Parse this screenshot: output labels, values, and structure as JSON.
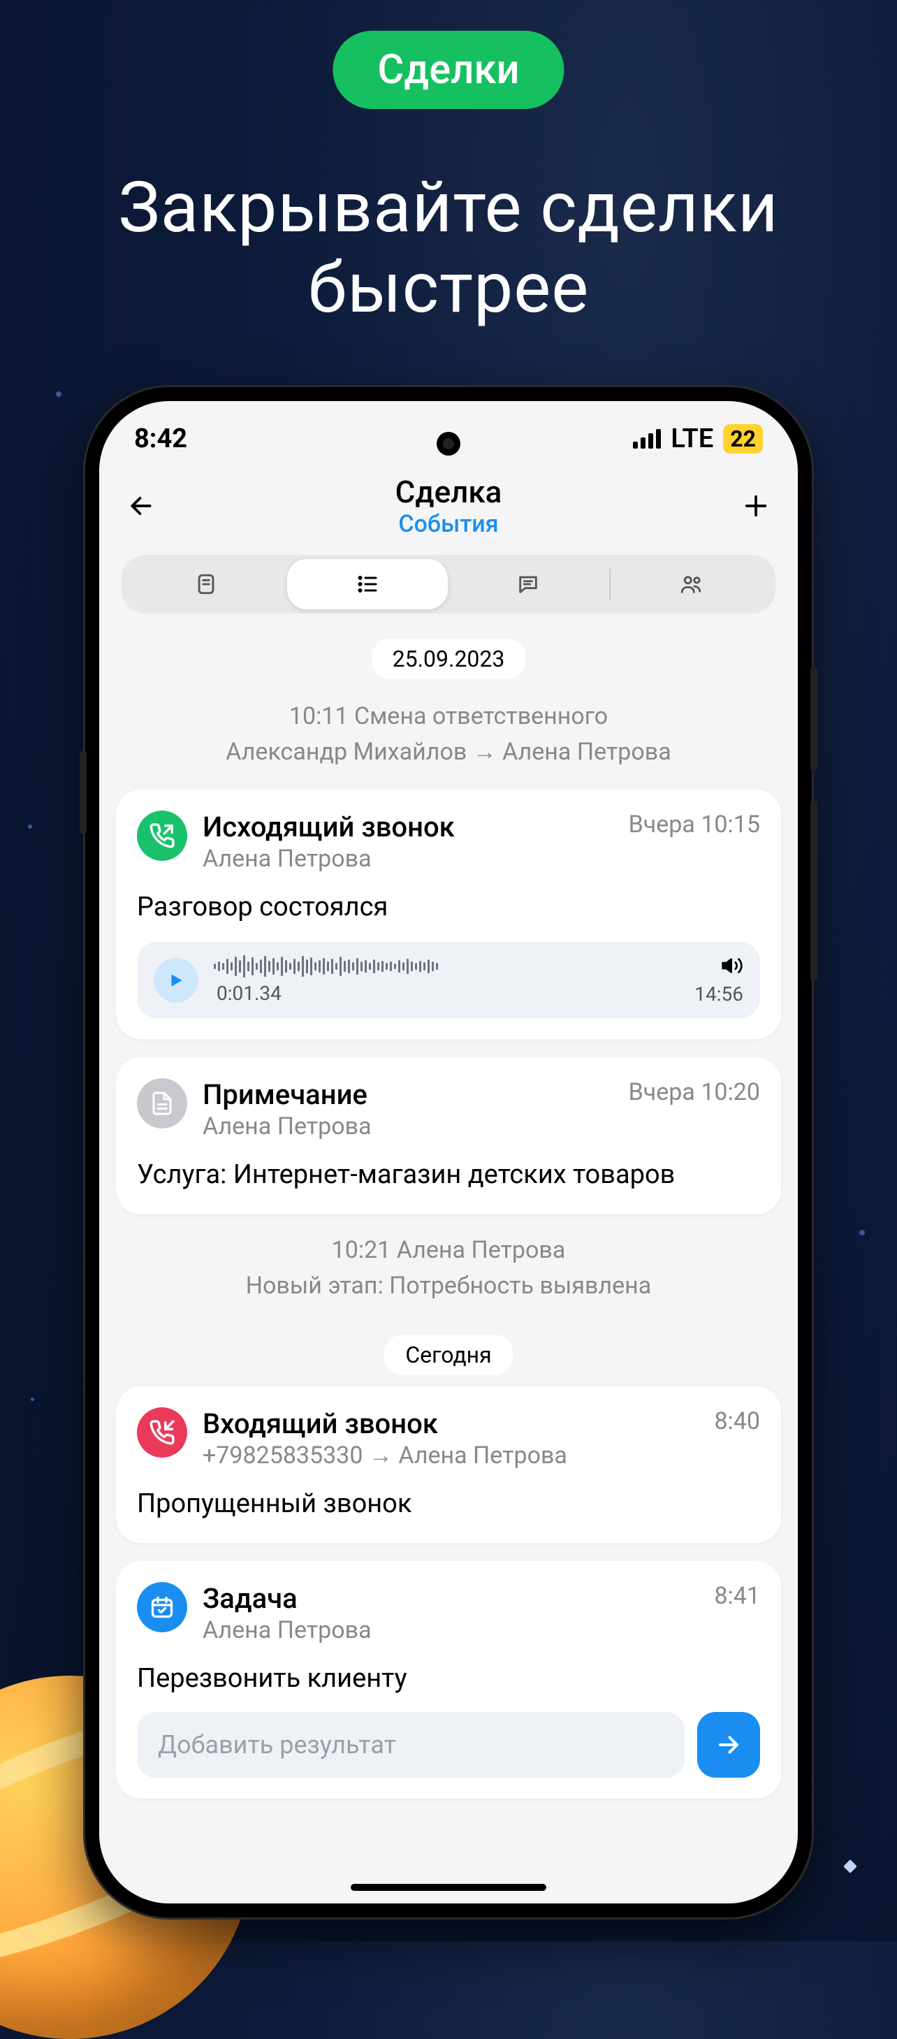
{
  "marketing": {
    "badge": "Сделки",
    "headline_l1": "Закрывайте сделки",
    "headline_l2": "быстрее"
  },
  "status": {
    "time": "8:42",
    "network": "LTE",
    "battery": "22"
  },
  "header": {
    "title": "Сделка",
    "subtitle": "События"
  },
  "timeline": {
    "date1": "25.09.2023",
    "sys1_l1": "10:11 Смена ответственного",
    "sys1_l2": "Александр Михайлов → Алена Петрова",
    "sys2_l1": "10:21 Алена Петрова",
    "sys2_l2": "Новый этап: Потребность выявлена",
    "date2": "Сегодня"
  },
  "cards": {
    "call_out": {
      "title": "Исходящий звонок",
      "sub": "Алена Петрова",
      "time": "Вчера 10:15",
      "body": "Разговор состоялся",
      "elapsed": "0:01.34",
      "duration": "14:56"
    },
    "note": {
      "title": "Примечание",
      "sub": "Алена Петрова",
      "time": "Вчера 10:20",
      "body": "Услуга: Интернет-магазин детских товаров"
    },
    "call_in": {
      "title": "Входящий звонок",
      "sub": "+79825835330 → Алена Петрова",
      "time": "8:40",
      "body": "Пропущенный звонок"
    },
    "task": {
      "title": "Задача",
      "sub": "Алена Петрова",
      "time": "8:41",
      "body": "Перезвонить клиенту",
      "placeholder": "Добавить результат"
    }
  }
}
